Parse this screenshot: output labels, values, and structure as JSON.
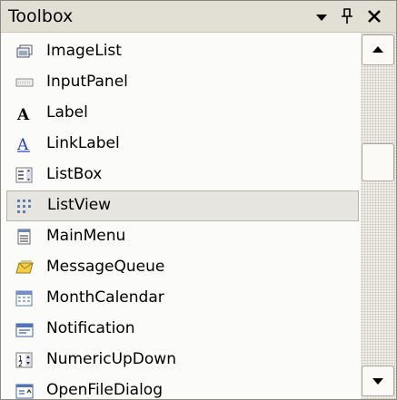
{
  "window": {
    "title": "Toolbox",
    "buttons": {
      "dropdown": "▾",
      "pin": "ᛘ",
      "close": "✕"
    }
  },
  "items": [
    {
      "label": "ImageList",
      "icon": "imagelist-icon"
    },
    {
      "label": "InputPanel",
      "icon": "inputpanel-icon"
    },
    {
      "label": "Label",
      "icon": "label-icon"
    },
    {
      "label": "LinkLabel",
      "icon": "linklabel-icon"
    },
    {
      "label": "ListBox",
      "icon": "listbox-icon"
    },
    {
      "label": "ListView",
      "icon": "listview-icon",
      "selected": true
    },
    {
      "label": "MainMenu",
      "icon": "mainmenu-icon"
    },
    {
      "label": "MessageQueue",
      "icon": "messagequeue-icon"
    },
    {
      "label": "MonthCalendar",
      "icon": "monthcalendar-icon"
    },
    {
      "label": "Notification",
      "icon": "notification-icon"
    },
    {
      "label": "NumericUpDown",
      "icon": "numericupdown-icon"
    },
    {
      "label": "OpenFileDialog",
      "icon": "openfiledialog-icon"
    }
  ],
  "colors": {
    "titlebar": "#e2dfd5",
    "selection": "#e6e5e0",
    "link": "#1f3fc8"
  }
}
